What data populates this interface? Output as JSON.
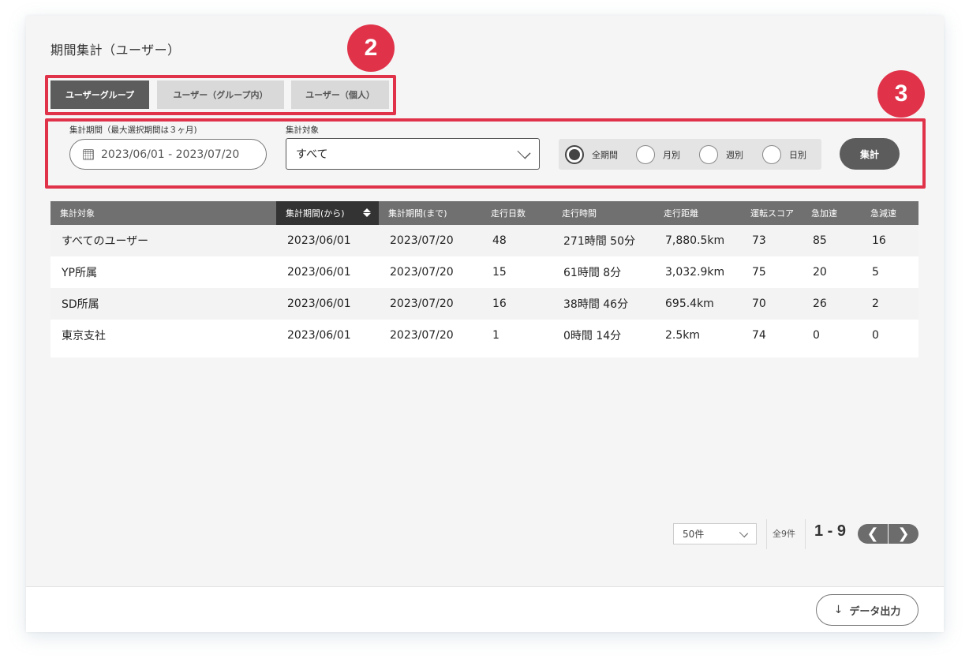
{
  "page_title": "期間集計（ユーザー）",
  "badges": {
    "tabs": "2",
    "filters": "3"
  },
  "accent_color": "#e0334a",
  "tabs": [
    {
      "label": "ユーザーグループ",
      "active": true
    },
    {
      "label": "ユーザー（グループ内）",
      "active": false
    },
    {
      "label": "ユーザー（個人）",
      "active": false
    }
  ],
  "filters": {
    "period_label": "集計期間（最大選択期間は３ヶ月)",
    "period_value": "2023/06/01 - 2023/07/20",
    "target_label": "集計対象",
    "target_value": "すべて",
    "radios": [
      {
        "label": "全期間",
        "selected": true
      },
      {
        "label": "月別",
        "selected": false
      },
      {
        "label": "週別",
        "selected": false
      },
      {
        "label": "日別",
        "selected": false
      }
    ],
    "aggregate_button": "集計"
  },
  "table": {
    "columns": [
      "集計対象",
      "集計期間(から)",
      "集計期間(まで)",
      "走行日数",
      "走行時間",
      "走行距離",
      "運転スコア",
      "急加速",
      "急減速"
    ],
    "sorted_column": 1,
    "rows": [
      [
        "すべてのユーザー",
        "2023/06/01",
        "2023/07/20",
        "48",
        "271時間 50分",
        "7,880.5km",
        "73",
        "85",
        "16"
      ],
      [
        "YP所属",
        "2023/06/01",
        "2023/07/20",
        "15",
        "61時間 8分",
        "3,032.9km",
        "75",
        "20",
        "5"
      ],
      [
        "SD所属",
        "2023/06/01",
        "2023/07/20",
        "16",
        "38時間 46分",
        "695.4km",
        "70",
        "26",
        "2"
      ],
      [
        "東京支社",
        "2023/06/01",
        "2023/07/20",
        "1",
        "0時間 14分",
        "2.5km",
        "74",
        "0",
        "0"
      ]
    ]
  },
  "pager": {
    "per_page": "50件",
    "total": "全9件",
    "range": "1 - 9",
    "prev": "❮",
    "next": "❯"
  },
  "footer": {
    "export_label": "データ出力",
    "export_icon": "↓"
  }
}
